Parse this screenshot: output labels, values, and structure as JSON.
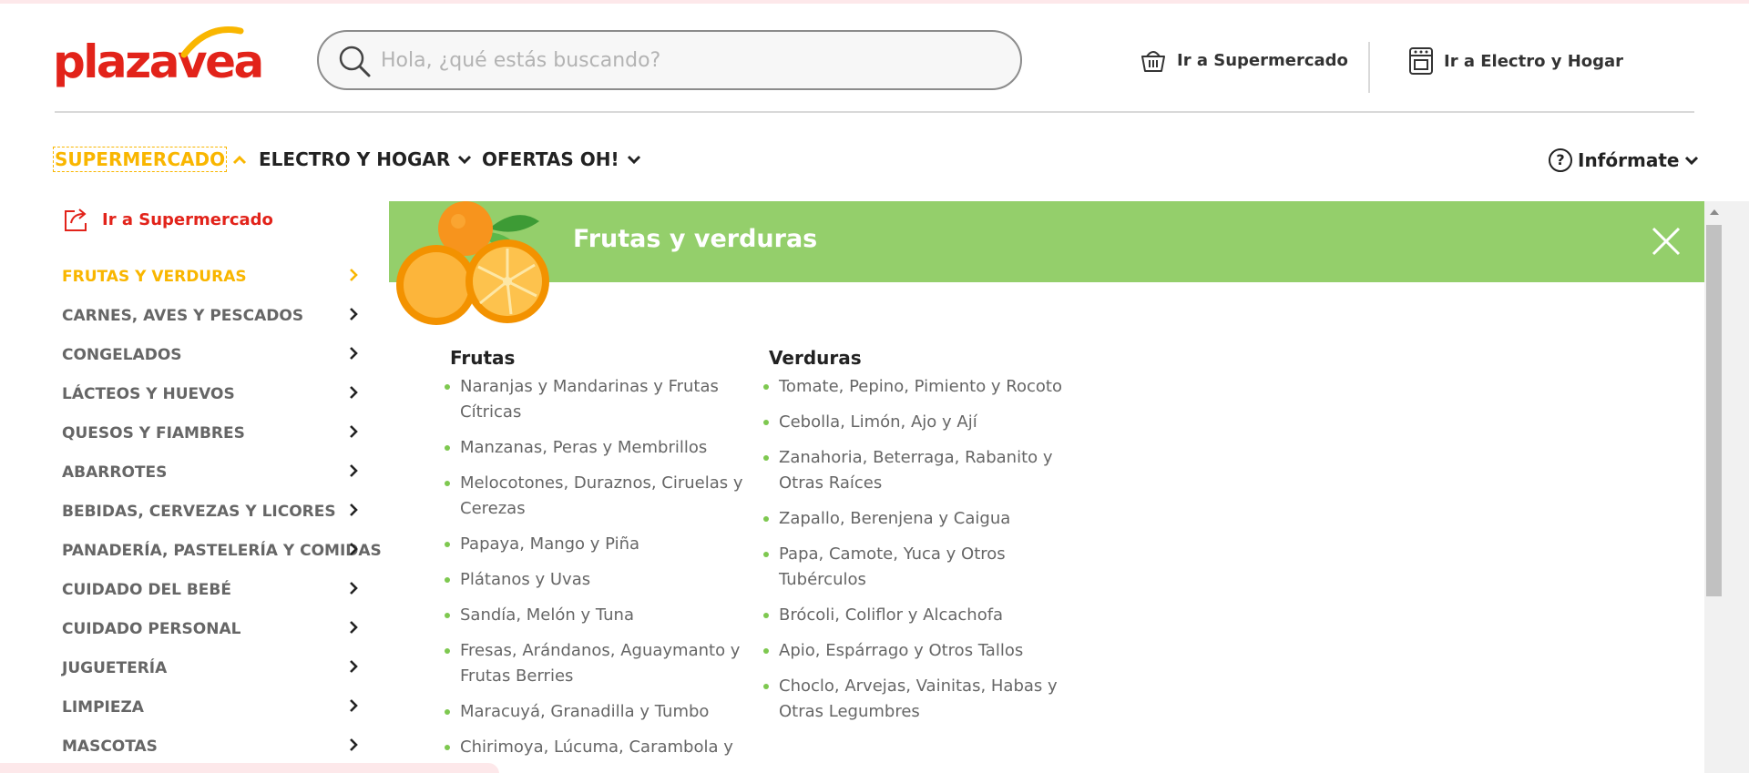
{
  "brand": {
    "logo_text": "plazavea",
    "accent": "#e2231a",
    "arc_color": "#f9b600"
  },
  "header": {
    "search_placeholder": "Hola, ¿qué estás buscando?",
    "supermarket_link": "Ir a Supermercado",
    "electro_link": "Ir a Electro y Hogar"
  },
  "nav": {
    "supermercado": "SUPERMERCADO",
    "electro": "ELECTRO Y HOGAR",
    "ofertas": "OFERTAS OH!",
    "informate": "Infórmate",
    "info_glyph": "?"
  },
  "sidebar": {
    "go_supermarket": "Ir a Supermercado",
    "categories": [
      "FRUTAS Y VERDURAS",
      "CARNES, AVES Y PESCADOS",
      "CONGELADOS",
      "LÁCTEOS Y HUEVOS",
      "QUESOS Y FIAMBRES",
      "ABARROTES",
      "BEBIDAS, CERVEZAS Y LICORES",
      "PANADERÍA, PASTELERÍA Y COMIDAS",
      "CUIDADO DEL BEBÉ",
      "CUIDADO PERSONAL",
      "JUGUETERÍA",
      "LIMPIEZA",
      "MASCOTAS"
    ]
  },
  "panel": {
    "title": "Frutas y verduras",
    "banner_color": "#94cf6b",
    "frutas": {
      "heading": "Frutas",
      "items": [
        "Naranjas y Mandarinas y Frutas Cítricas",
        "Manzanas, Peras y Membrillos",
        "Melocotones, Duraznos, Ciruelas y Cerezas",
        "Papaya, Mango y Piña",
        "Plátanos y Uvas",
        "Sandía, Melón y Tuna",
        "Fresas, Arándanos, Aguaymanto y Frutas Berries",
        "Maracuyá, Granadilla y Tumbo",
        "Chirimoya, Lúcuma, Carambola y"
      ]
    },
    "verduras": {
      "heading": "Verduras",
      "items": [
        "Tomate, Pepino, Pimiento y Rocoto",
        "Cebolla, Limón, Ajo y Ají",
        "Zanahoria, Beterraga, Rabanito y Otras Raíces",
        "Zapallo, Berenjena y Caigua",
        "Papa, Camote, Yuca y Otros Tubérculos",
        "Brócoli, Coliflor y Alcachofa",
        "Apio, Espárrago y Otros Tallos",
        "Choclo, Arvejas, Vainitas, Habas y Otras Legumbres"
      ]
    }
  }
}
